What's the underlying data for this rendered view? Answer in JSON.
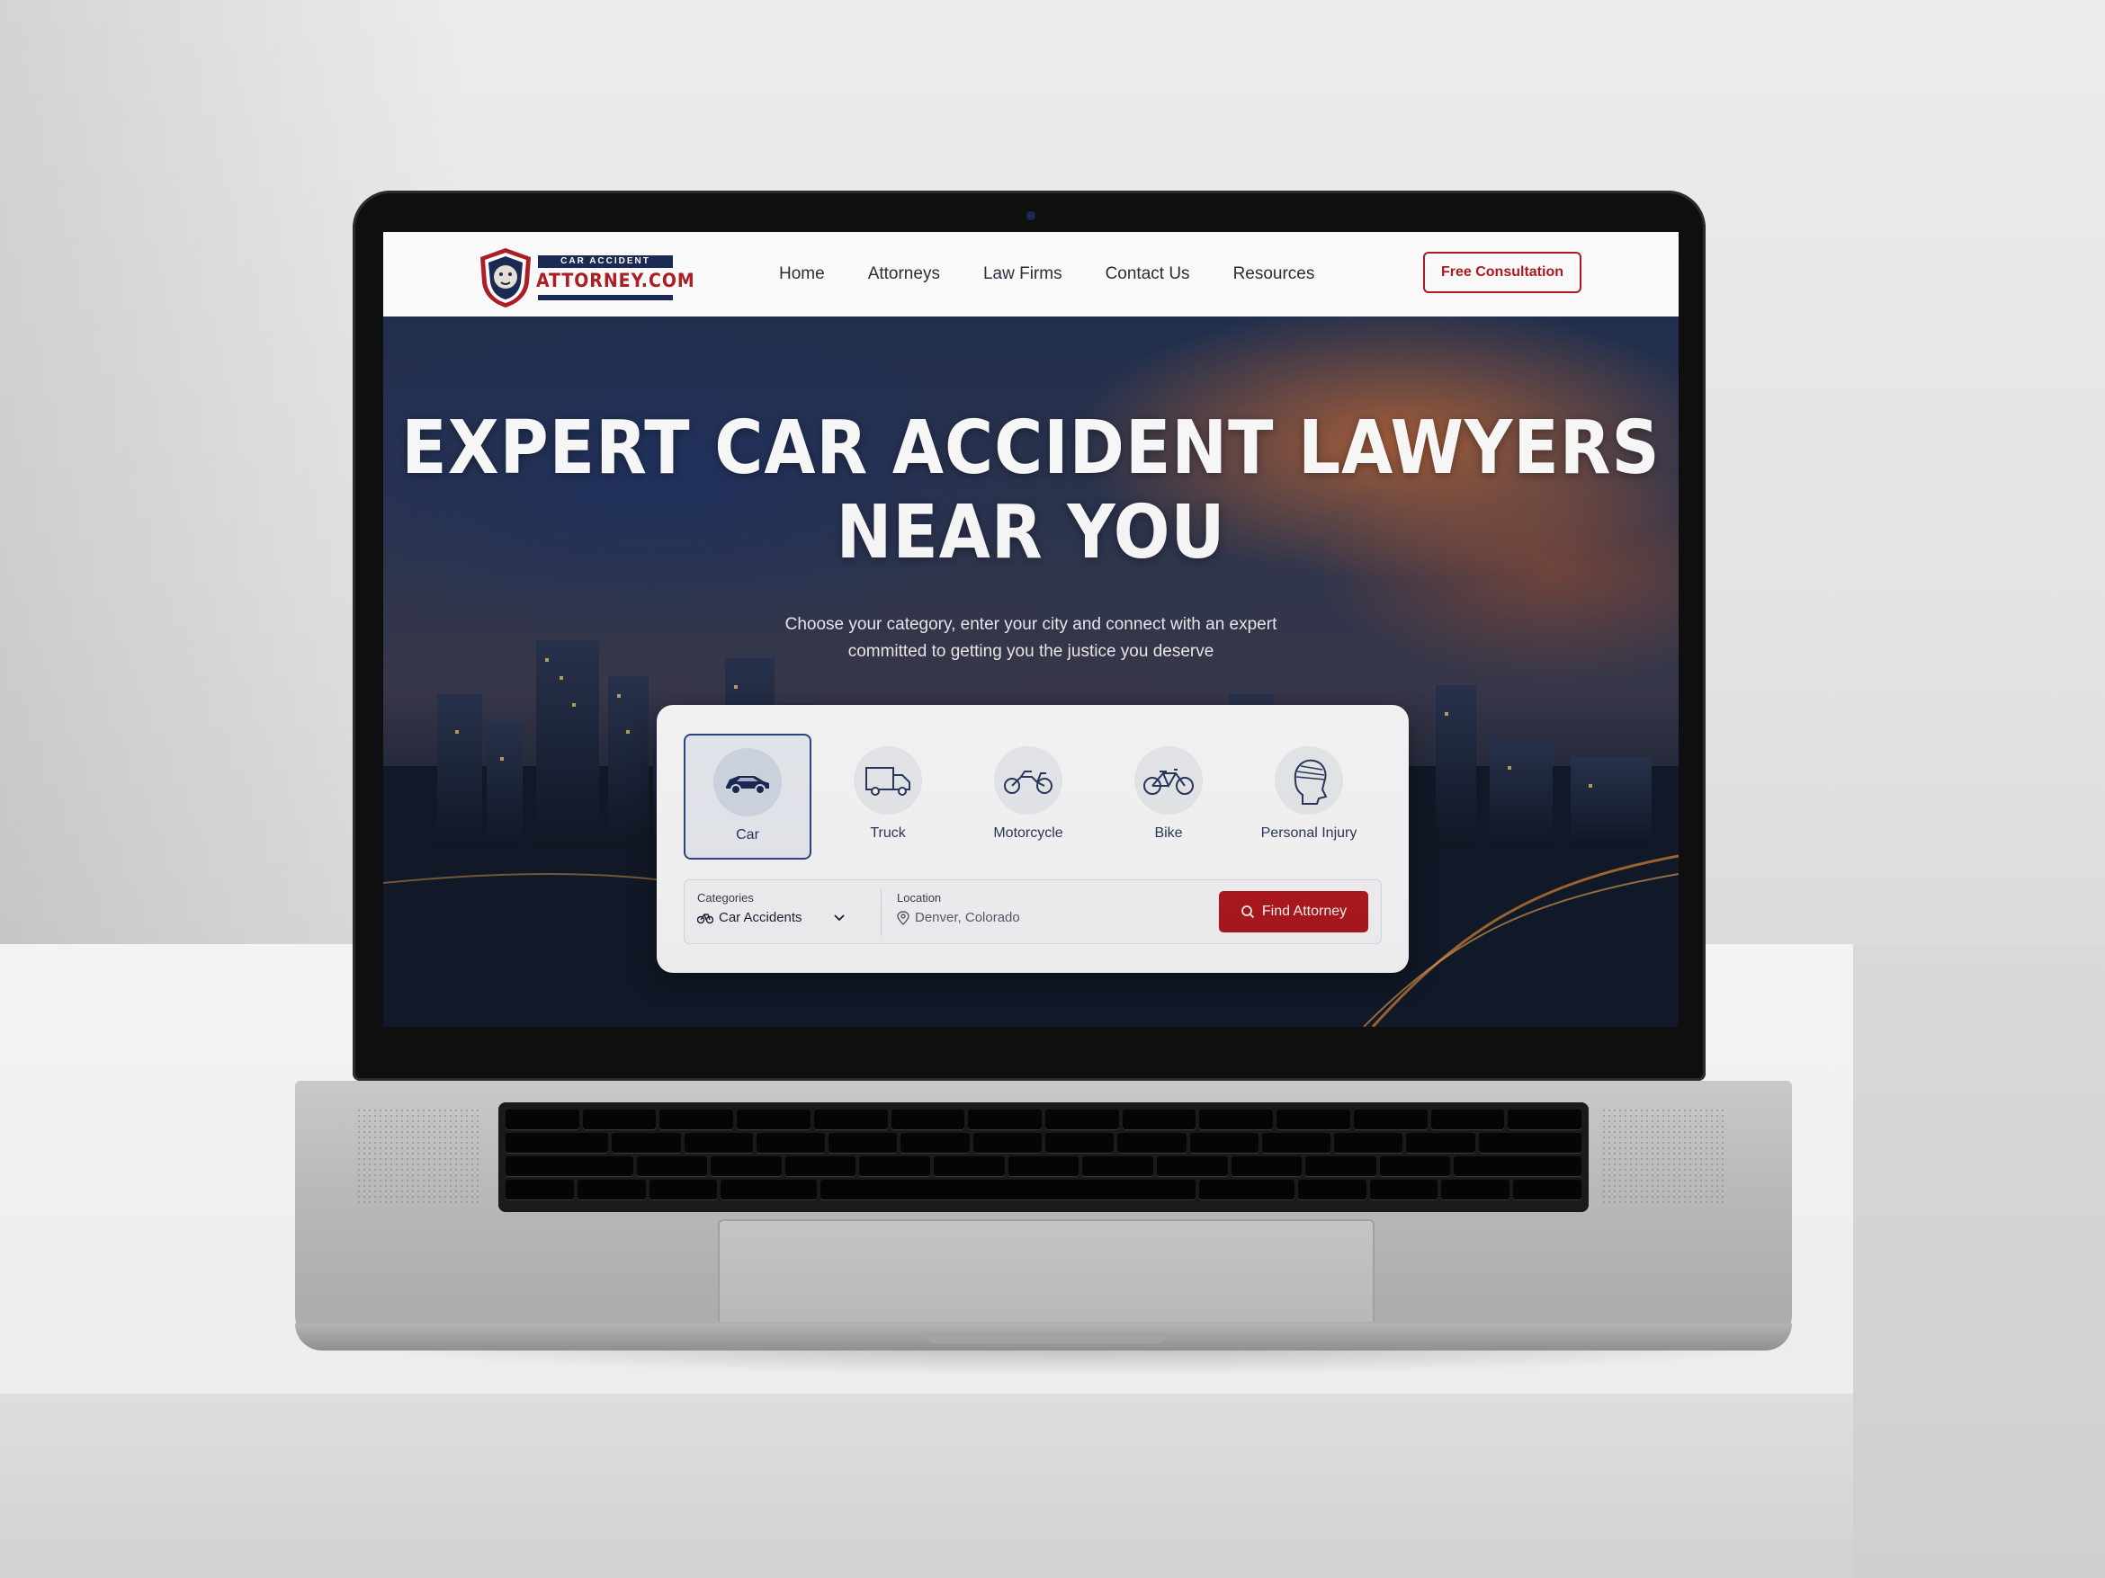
{
  "logo": {
    "line1": "CAR ACCIDENT",
    "line2": "ATTORNEY.COM",
    "icon": "lion-shield-icon"
  },
  "nav": {
    "items": [
      {
        "label": "Home"
      },
      {
        "label": "Attorneys"
      },
      {
        "label": "Law Firms"
      },
      {
        "label": "Contact Us"
      },
      {
        "label": "Resources"
      }
    ],
    "cta_label": "Free Consultation"
  },
  "hero": {
    "title_line1": "EXPERT CAR ACCIDENT LAWYERS",
    "title_line2": "NEAR YOU",
    "subtitle_line1": "Choose your category, enter your city and connect with an expert",
    "subtitle_line2": "committed to getting you the justice you deserve"
  },
  "categories": [
    {
      "label": "Car",
      "icon": "car-icon",
      "selected": true
    },
    {
      "label": "Truck",
      "icon": "truck-icon",
      "selected": false
    },
    {
      "label": "Motorcycle",
      "icon": "motorcycle-icon",
      "selected": false
    },
    {
      "label": "Bike",
      "icon": "bicycle-icon",
      "selected": false
    },
    {
      "label": "Personal Injury",
      "icon": "head-bandage-icon",
      "selected": false
    }
  ],
  "search": {
    "category_label": "Categories",
    "category_value": "Car Accidents",
    "location_label": "Location",
    "location_value": "Denver, Colorado",
    "button_label": "Find Attorney"
  },
  "colors": {
    "brand_red": "#b3191f",
    "brand_navy": "#1c2b55"
  }
}
